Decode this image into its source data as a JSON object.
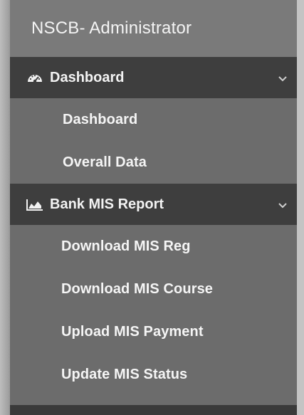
{
  "sidebar": {
    "brand": "NSCB- Administrator",
    "sections": [
      {
        "label": "Dashboard",
        "icon": "dashboard-gauge-icon",
        "items": [
          "Dashboard",
          "Overall Data"
        ]
      },
      {
        "label": "Bank MIS Report",
        "icon": "area-chart-icon",
        "items": [
          "Download MIS Reg",
          "Download MIS Course",
          "Upload MIS Payment",
          "Update MIS Status"
        ]
      }
    ]
  }
}
